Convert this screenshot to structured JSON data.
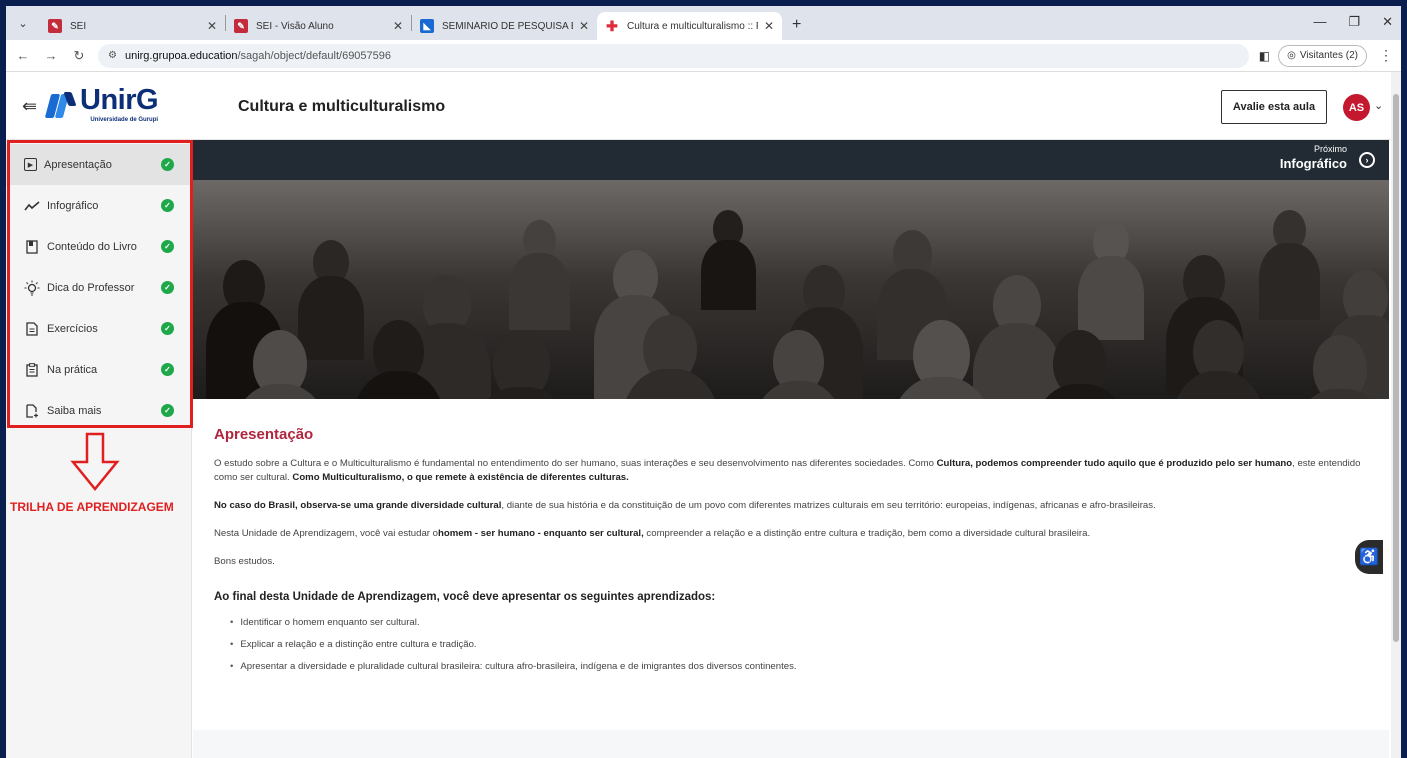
{
  "browser": {
    "tabs": [
      {
        "title": "SEI",
        "favicon_color": "#c42b3b"
      },
      {
        "title": "SEI - Visão Aluno",
        "favicon_color": "#c42b3b"
      },
      {
        "title": "SEMINÁRIO DE PESQUISA EM L",
        "favicon_color": "#1a6ad3"
      },
      {
        "title": "Cultura e multiculturalismo :: Pl",
        "favicon_color": "#e02b3a",
        "active": true
      }
    ],
    "url_host": "unirg.grupoa.education",
    "url_path": "/sagah/object/default/69057596",
    "profile_label": "Visitantes (2)"
  },
  "header": {
    "logo_name": "UnirG",
    "logo_sub": "Universidade de Gurupi",
    "title": "Cultura e multiculturalismo",
    "rate_label": "Avalie esta aula",
    "avatar_initials": "AS"
  },
  "sidebar": {
    "items": [
      {
        "label": "Apresentação",
        "icon": "play-square-icon",
        "glyph": "▶",
        "active": true
      },
      {
        "label": "Infográfico",
        "icon": "trend-icon",
        "glyph": "〰"
      },
      {
        "label": "Conteúdo do Livro",
        "icon": "book-icon",
        "glyph": "▮"
      },
      {
        "label": "Dica do Professor",
        "icon": "bulb-icon",
        "glyph": "✺"
      },
      {
        "label": "Exercícios",
        "icon": "document-icon",
        "glyph": "▤"
      },
      {
        "label": "Na prática",
        "icon": "clipboard-icon",
        "glyph": "▦"
      },
      {
        "label": "Saiba mais",
        "icon": "file-plus-icon",
        "glyph": "▢"
      }
    ],
    "annotation": "TRILHA DE APRENDIZAGEM"
  },
  "next": {
    "small": "Próximo",
    "big": "Infográfico"
  },
  "article": {
    "heading": "Apresentação",
    "p1_a": "O estudo sobre a Cultura e o Multiculturalismo é fundamental no entendimento do ser humano, suas interações e seu desenvolvimento nas diferentes sociedades. Como ",
    "p1_b": "Cultura, podemos compreender tudo aquilo que é produzido pelo ser humano",
    "p1_c": ", este entendido como ser cultural. ",
    "p1_d": "Como Multiculturalismo, o que remete à existência de diferentes culturas.",
    "p2_a": "No caso do Brasil, observa-se uma grande diversidade cultural",
    "p2_b": ", diante de sua história e da constituição de um povo com diferentes matrizes culturais em seu território: europeias, indígenas, africanas e afro-brasileiras.",
    "p3_a": "Nesta Unidade de Aprendizagem, você vai estudar o",
    "p3_b": "homem - ser humano - enquanto ser cultural,",
    "p3_c": " compreender a relação e a distinção entre cultura e tradição, bem como a diversidade cultural brasileira.",
    "p4": "Bons estudos.",
    "subheading": "Ao final desta Unidade de Aprendizagem, você deve apresentar os seguintes aprendizados:",
    "goals": [
      "Identificar o homem enquanto ser cultural.",
      "Explicar a relação e a distinção entre cultura e tradição.",
      "Apresentar a diversidade e pluralidade cultural brasileira: cultura afro-brasileira, indígena e de imigrantes dos diversos continentes."
    ]
  },
  "colors": {
    "accent": "#b0263d",
    "check": "#1fa84a",
    "annotation": "#e02020",
    "frame": "#0b1f4f"
  }
}
